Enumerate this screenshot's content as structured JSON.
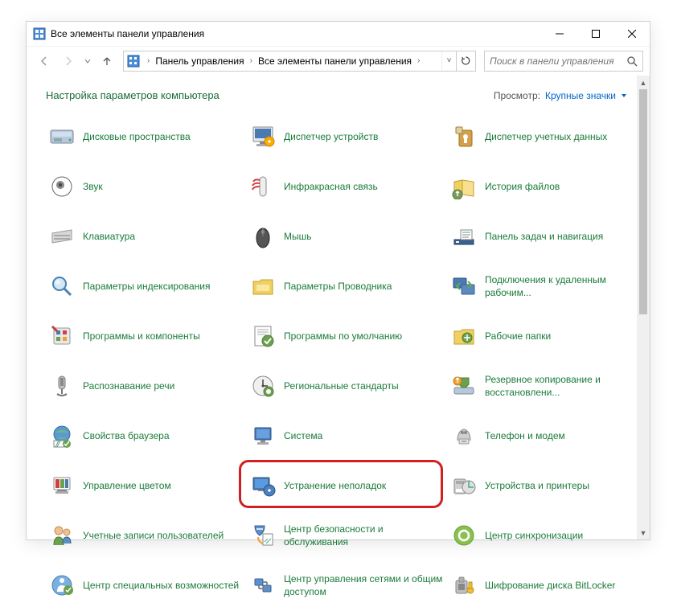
{
  "window": {
    "title": "Все элементы панели управления"
  },
  "breadcrumb": {
    "seg1": "Панель управления",
    "seg2": "Все элементы панели управления"
  },
  "search": {
    "placeholder": "Поиск в панели управления"
  },
  "header": {
    "title": "Настройка параметров компьютера",
    "view_label": "Просмотр:",
    "view_value": "Крупные значки"
  },
  "items": [
    {
      "label": "Дисковые пространства"
    },
    {
      "label": "Диспетчер устройств"
    },
    {
      "label": "Диспетчер учетных данных"
    },
    {
      "label": "Звук"
    },
    {
      "label": "Инфракрасная связь"
    },
    {
      "label": "История файлов"
    },
    {
      "label": "Клавиатура"
    },
    {
      "label": "Мышь"
    },
    {
      "label": "Панель задач и навигация"
    },
    {
      "label": "Параметры индексирования"
    },
    {
      "label": "Параметры Проводника"
    },
    {
      "label": "Подключения к удаленным рабочим..."
    },
    {
      "label": "Программы и компоненты"
    },
    {
      "label": "Программы по умолчанию"
    },
    {
      "label": "Рабочие папки"
    },
    {
      "label": "Распознавание речи"
    },
    {
      "label": "Региональные стандарты"
    },
    {
      "label": "Резервное копирование и восстановлени..."
    },
    {
      "label": "Свойства браузера"
    },
    {
      "label": "Система"
    },
    {
      "label": "Телефон и модем"
    },
    {
      "label": "Управление цветом"
    },
    {
      "label": "Устранение неполадок"
    },
    {
      "label": "Устройства и принтеры"
    },
    {
      "label": "Учетные записи пользователей"
    },
    {
      "label": "Центр безопасности и обслуживания"
    },
    {
      "label": "Центр синхронизации"
    },
    {
      "label": "Центр специальных возможностей"
    },
    {
      "label": "Центр управления сетями и общим доступом"
    },
    {
      "label": "Шифрование диска BitLocker"
    }
  ]
}
